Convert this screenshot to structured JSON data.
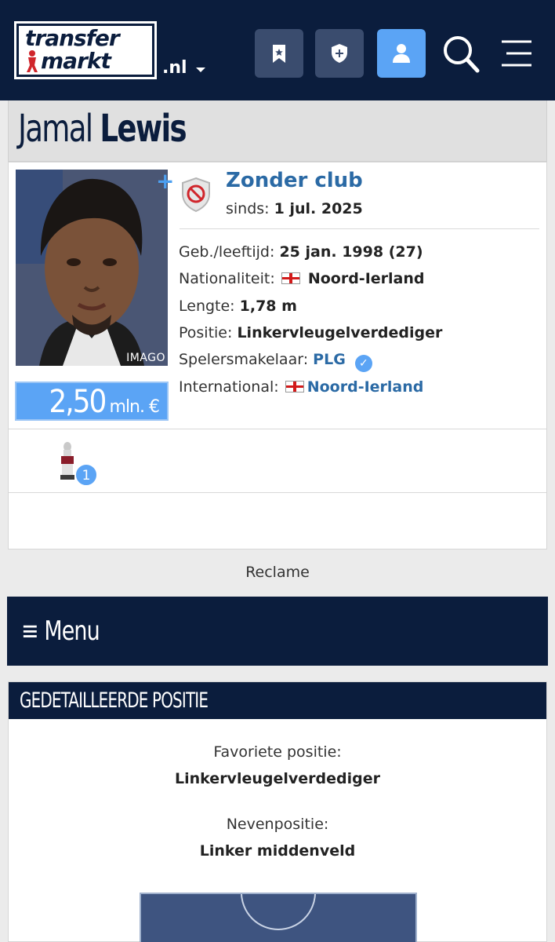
{
  "header": {
    "logo_line1": "transfer",
    "logo_line2": "markt",
    "domain": ".nl",
    "buttons": [
      "bookmark-icon",
      "shield-plus-icon",
      "user-icon",
      "search-icon",
      "hamburger-icon"
    ],
    "colors": {
      "navy": "#0b1d3d",
      "accent": "#5ba4f5",
      "button": "#3a4c6e"
    }
  },
  "player": {
    "first_name": "Jamal",
    "last_name": "Lewis",
    "photo_credit": "IMAGO",
    "market_value": "2,50",
    "market_value_unit": "mln. €",
    "club": "Zonder club",
    "since_label": "sinds:",
    "since_value": "1 jul. 2025",
    "info": {
      "birth_label": "Geb./leeftijd:",
      "birth_value": "25 jan. 1998 (27)",
      "nationality_label": "Nationaliteit:",
      "nationality_value": "Noord-Ierland",
      "height_label": "Lengte:",
      "height_value": "1,78 m",
      "position_label": "Positie:",
      "position_value": "Linkervleugelverdediger",
      "agent_label": "Spelersmakelaar:",
      "agent_value": "PLG",
      "international_label": "International:",
      "international_value": "Noord-Ierland"
    },
    "trophy_count": "1"
  },
  "reclame": "Reclame",
  "menu": {
    "label": "≡ Menu"
  },
  "position_section": {
    "title": "GEDETAILLEERDE POSITIE",
    "favorite_label": "Favoriete positie:",
    "favorite_value": "Linkervleugelverdediger",
    "secondary_label": "Nevenpositie:",
    "secondary_value": "Linker middenveld"
  }
}
